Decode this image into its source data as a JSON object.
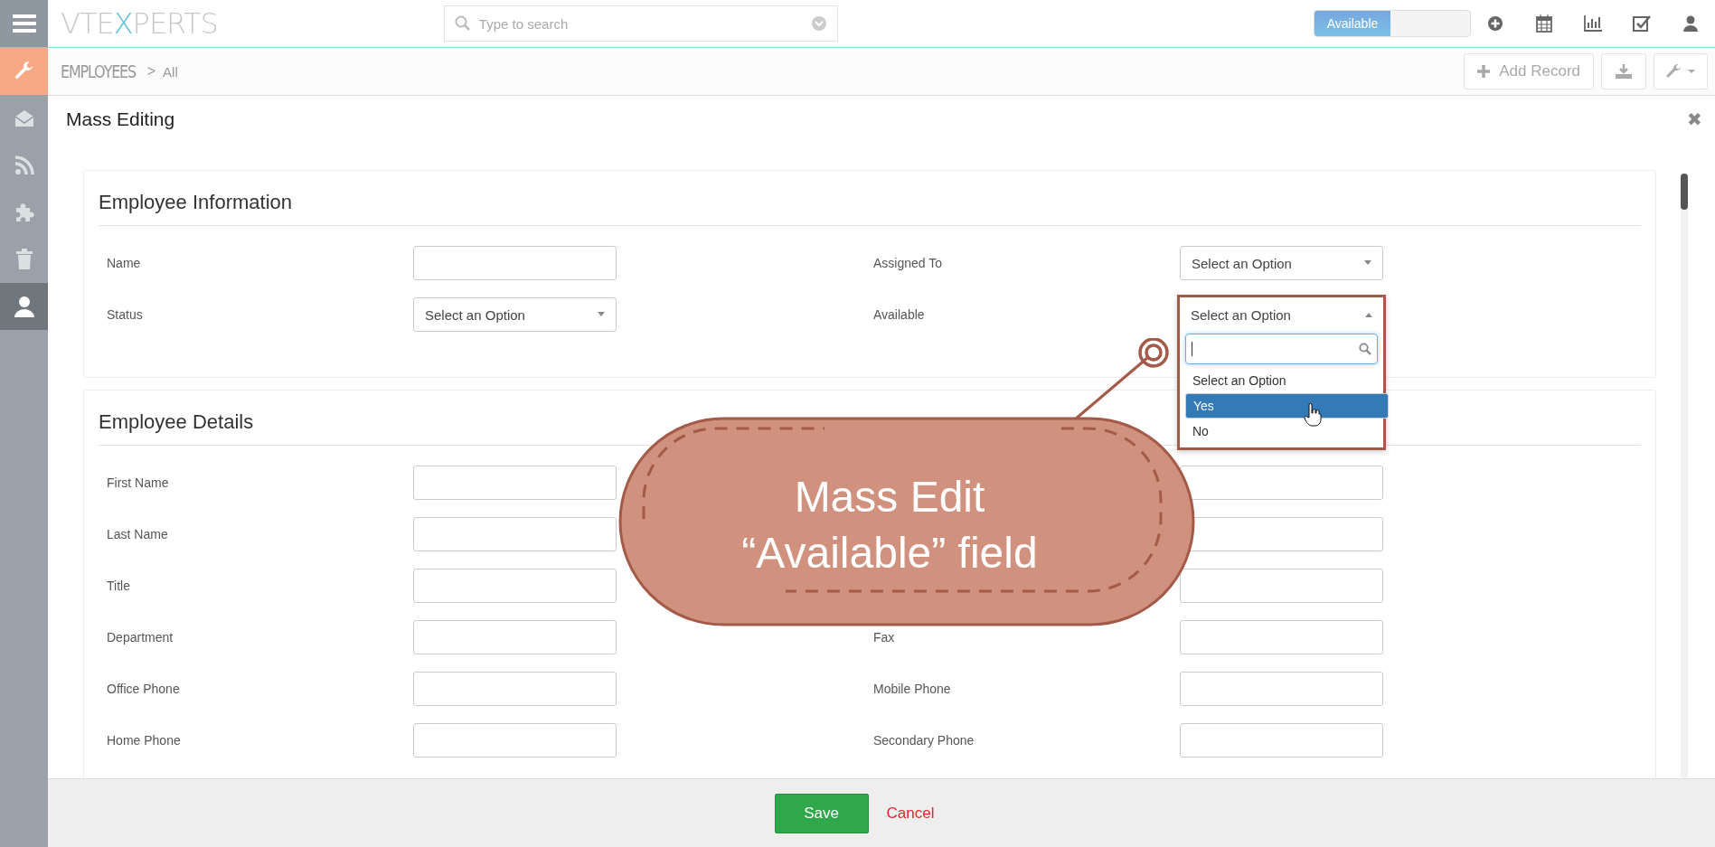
{
  "topbar": {
    "logo": [
      {
        "text": "VTE",
        "accent": false
      },
      {
        "text": "X",
        "accent": true
      },
      {
        "text": "PERTS",
        "accent": false
      }
    ],
    "search": {
      "placeholder": "Type to search"
    },
    "status_toggle": {
      "label": "Available",
      "on": true
    },
    "icons": [
      {
        "kind": "add"
      },
      {
        "kind": "calendar"
      },
      {
        "kind": "chart"
      },
      {
        "kind": "tasks"
      },
      {
        "kind": "user"
      }
    ]
  },
  "sidebar": {
    "items": [
      {
        "kind": "wrench",
        "selected": false
      },
      {
        "kind": "mail",
        "selected": false
      },
      {
        "kind": "rss",
        "selected": false
      },
      {
        "kind": "puzzle",
        "selected": false
      },
      {
        "kind": "trash",
        "selected": false
      },
      {
        "kind": "user",
        "selected": true
      }
    ]
  },
  "breadcrumb": {
    "module": "EMPLOYEES",
    "separator": ">",
    "view": "All"
  },
  "actions": {
    "add_record": "Add Record"
  },
  "modal": {
    "title": "Mass Editing",
    "close": "✖",
    "sections": [
      {
        "title": "Employee Information",
        "rows": [
          [
            {
              "label": "Name",
              "kind": "text"
            },
            {
              "label": "Assigned To",
              "kind": "select",
              "value": "Select an Option"
            }
          ],
          [
            {
              "label": "Status",
              "kind": "select",
              "value": "Select an Option"
            },
            {
              "label": "Available",
              "kind": "select",
              "value": "Select an Option",
              "open": true
            }
          ]
        ]
      },
      {
        "title": "Employee Details",
        "rows": [
          [
            {
              "label": "First Name",
              "kind": "text"
            },
            {
              "kind": "text"
            }
          ],
          [
            {
              "label": "Last Name",
              "kind": "text"
            },
            {
              "kind": "text"
            }
          ],
          [
            {
              "label": "Title",
              "kind": "text"
            },
            {
              "kind": "text"
            }
          ],
          [
            {
              "label": "Department",
              "kind": "text"
            },
            {
              "label": "Fax",
              "kind": "text"
            }
          ],
          [
            {
              "label": "Office Phone",
              "kind": "text"
            },
            {
              "label": "Mobile Phone",
              "kind": "text"
            }
          ],
          [
            {
              "label": "Home Phone",
              "kind": "text"
            },
            {
              "label": "Secondary Phone",
              "kind": "text"
            }
          ]
        ]
      }
    ],
    "dropdown": {
      "options": [
        {
          "label": "Select an Option",
          "selected": false
        },
        {
          "label": "Yes",
          "selected": true
        },
        {
          "label": "No",
          "selected": false
        }
      ]
    },
    "footer": {
      "save": "Save",
      "cancel": "Cancel"
    }
  },
  "callout": {
    "lines": [
      "Mass Edit",
      "“Available” field"
    ]
  }
}
